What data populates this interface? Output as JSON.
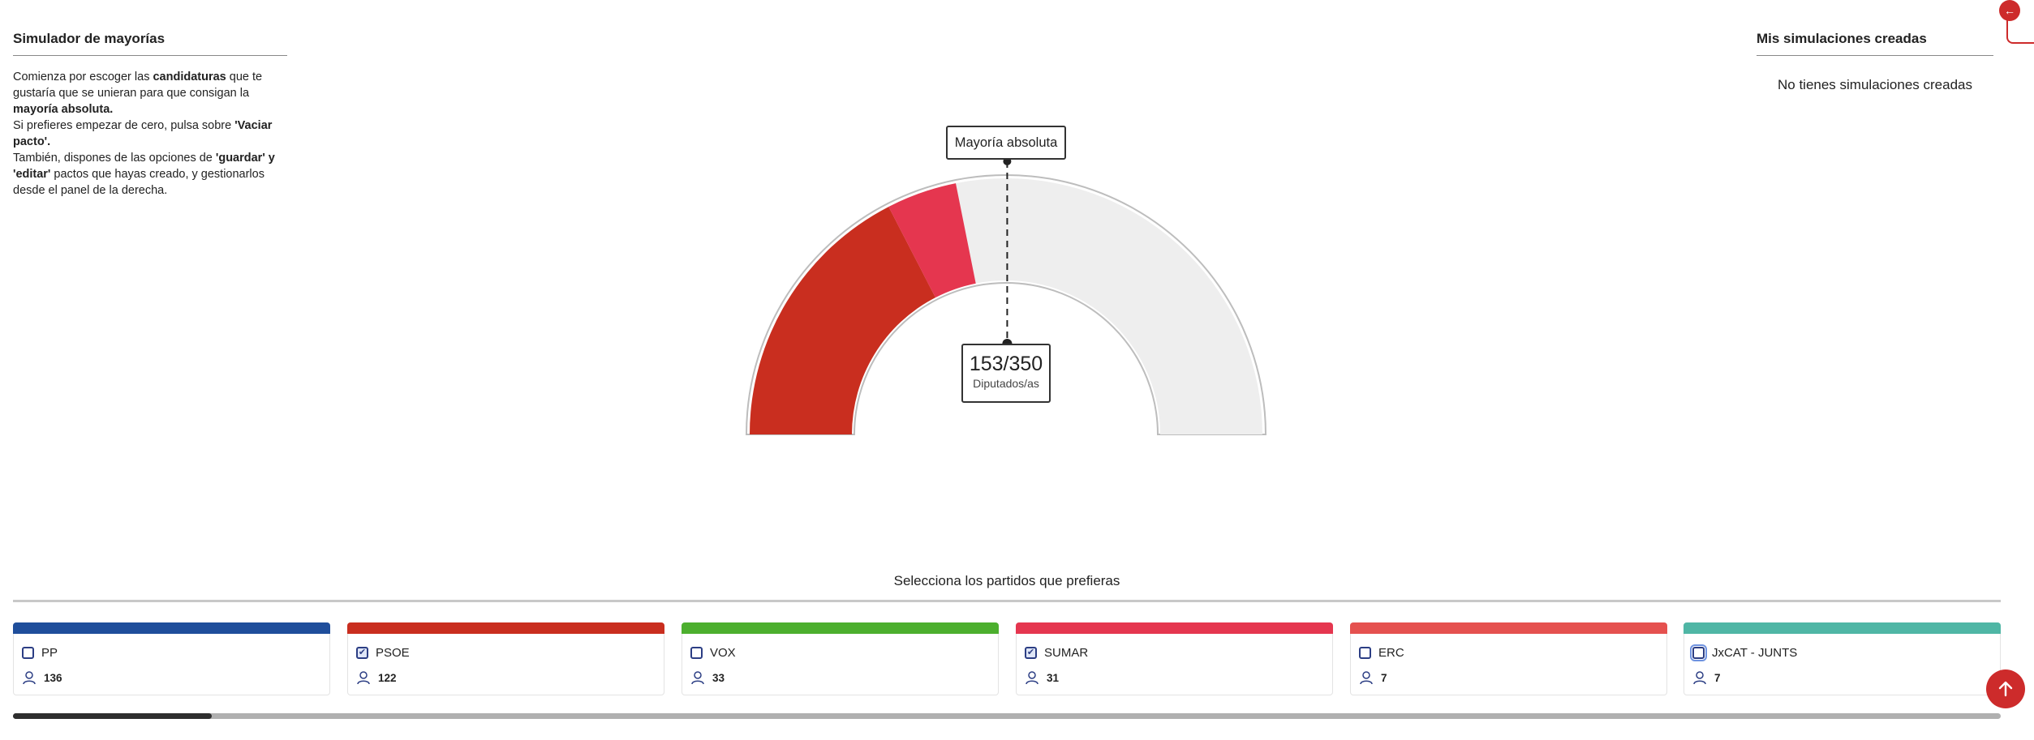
{
  "left_panel": {
    "title": "Simulador de mayorías",
    "intro_1a": "Comienza por escoger las ",
    "intro_1b": "candidaturas",
    "intro_1c": " que te gustaría que se unieran para que consigan la ",
    "intro_1d": "mayoría absoluta.",
    "intro_2a": "Si prefieres empezar de cero, pulsa sobre ",
    "intro_2b": "'Vaciar pacto'.",
    "intro_3a": "También, dispones de las opciones de ",
    "intro_3b": "'guardar' y 'editar'",
    "intro_3c": " pactos que hayas creado, y gestionarlos desde el panel de la derecha."
  },
  "right_panel": {
    "title": "Mis simulaciones creadas",
    "empty_text": "No tienes simulaciones creadas"
  },
  "gauge": {
    "majority_label": "Mayoría absoluta",
    "count": "153/350",
    "count_unit": "Diputados/as",
    "total_seats": 350,
    "majority_seats": 176,
    "segments": [
      {
        "party": "PSOE",
        "seats": 122,
        "color": "#c92e1f"
      },
      {
        "party": "SUMAR",
        "seats": 31,
        "color": "#e5364f"
      }
    ],
    "empty_color": "#eeeeee"
  },
  "selector": {
    "title": "Selecciona los partidos que prefieras",
    "parties": [
      {
        "name": "PP",
        "seats": "136",
        "color": "#1f4e9b",
        "checked": false,
        "focused": false
      },
      {
        "name": "PSOE",
        "seats": "122",
        "color": "#c92e1f",
        "checked": true,
        "focused": false
      },
      {
        "name": "VOX",
        "seats": "33",
        "color": "#4caf2e",
        "checked": false,
        "focused": false
      },
      {
        "name": "SUMAR",
        "seats": "31",
        "color": "#e5364f",
        "checked": true,
        "focused": false
      },
      {
        "name": "ERC",
        "seats": "7",
        "color": "#e5514f",
        "checked": false,
        "focused": false
      },
      {
        "name": "JxCAT - JUNTS",
        "seats": "7",
        "color": "#4fb6a5",
        "checked": false,
        "focused": true
      }
    ]
  },
  "scroll": {
    "position_fraction": 0.0,
    "visible_fraction": 0.1
  },
  "icons": {
    "back": "back-arrow-icon",
    "top": "arrow-up-icon",
    "seats": "user-icon",
    "check": "check-icon"
  },
  "colors": {
    "accent": "#cd2b2b",
    "checkbox": "#2c3e84"
  }
}
